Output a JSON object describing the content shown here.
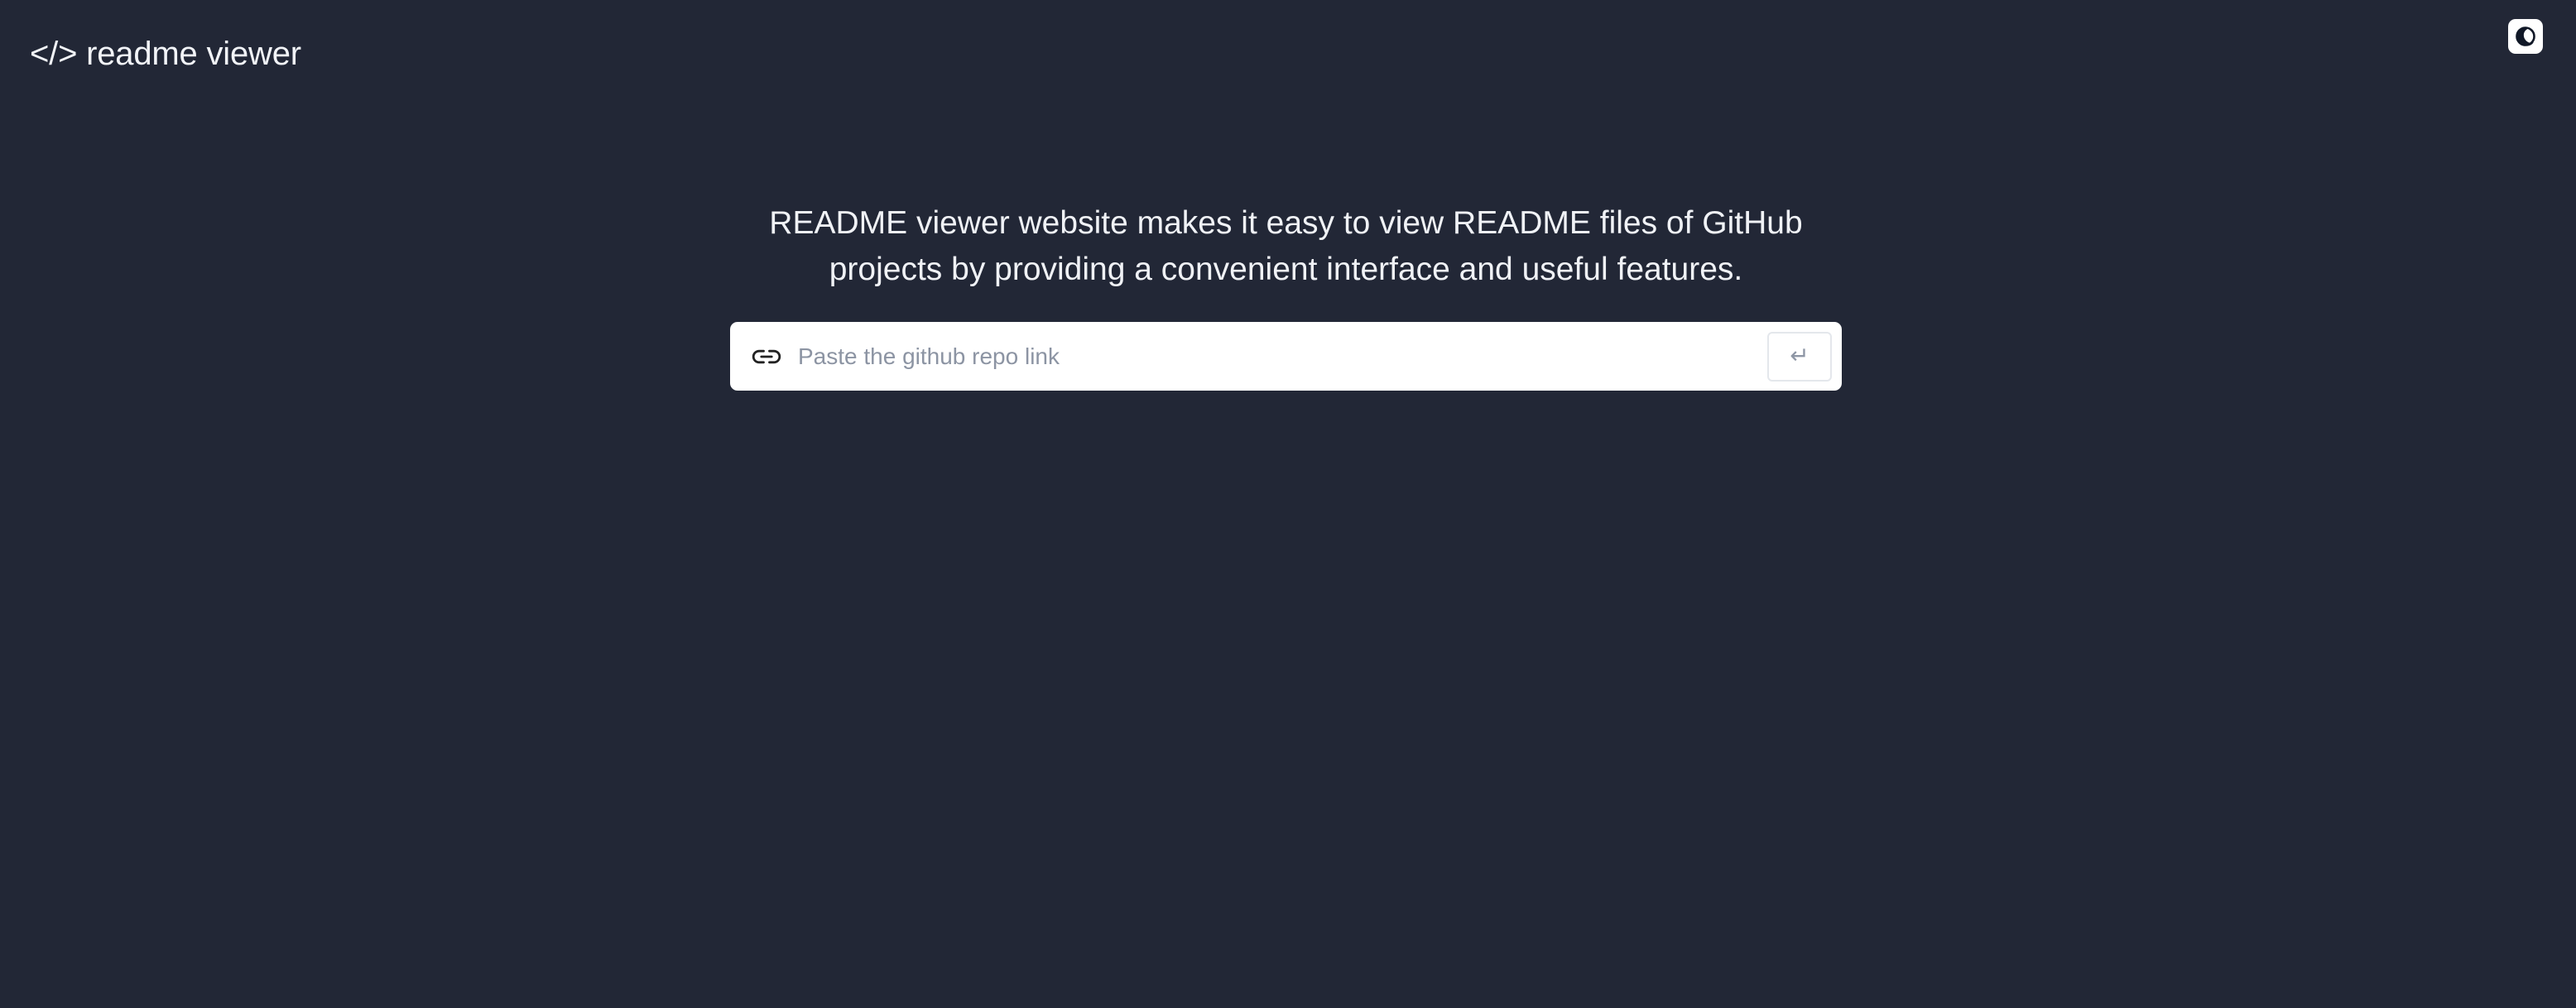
{
  "header": {
    "brand": "</> readme viewer",
    "theme_toggle_icon": "moon-icon"
  },
  "main": {
    "description": "README viewer website makes it easy to view README files of GitHub projects by providing a convenient interface and useful features.",
    "search": {
      "value": "",
      "placeholder": "Paste the github repo link",
      "link_icon": "link-icon",
      "submit_icon": "enter-icon",
      "submit_glyph": "↵"
    }
  },
  "colors": {
    "background": "#222736",
    "surface": "#ffffff",
    "text": "#f0f2f6",
    "placeholder": "#8c94a3"
  }
}
